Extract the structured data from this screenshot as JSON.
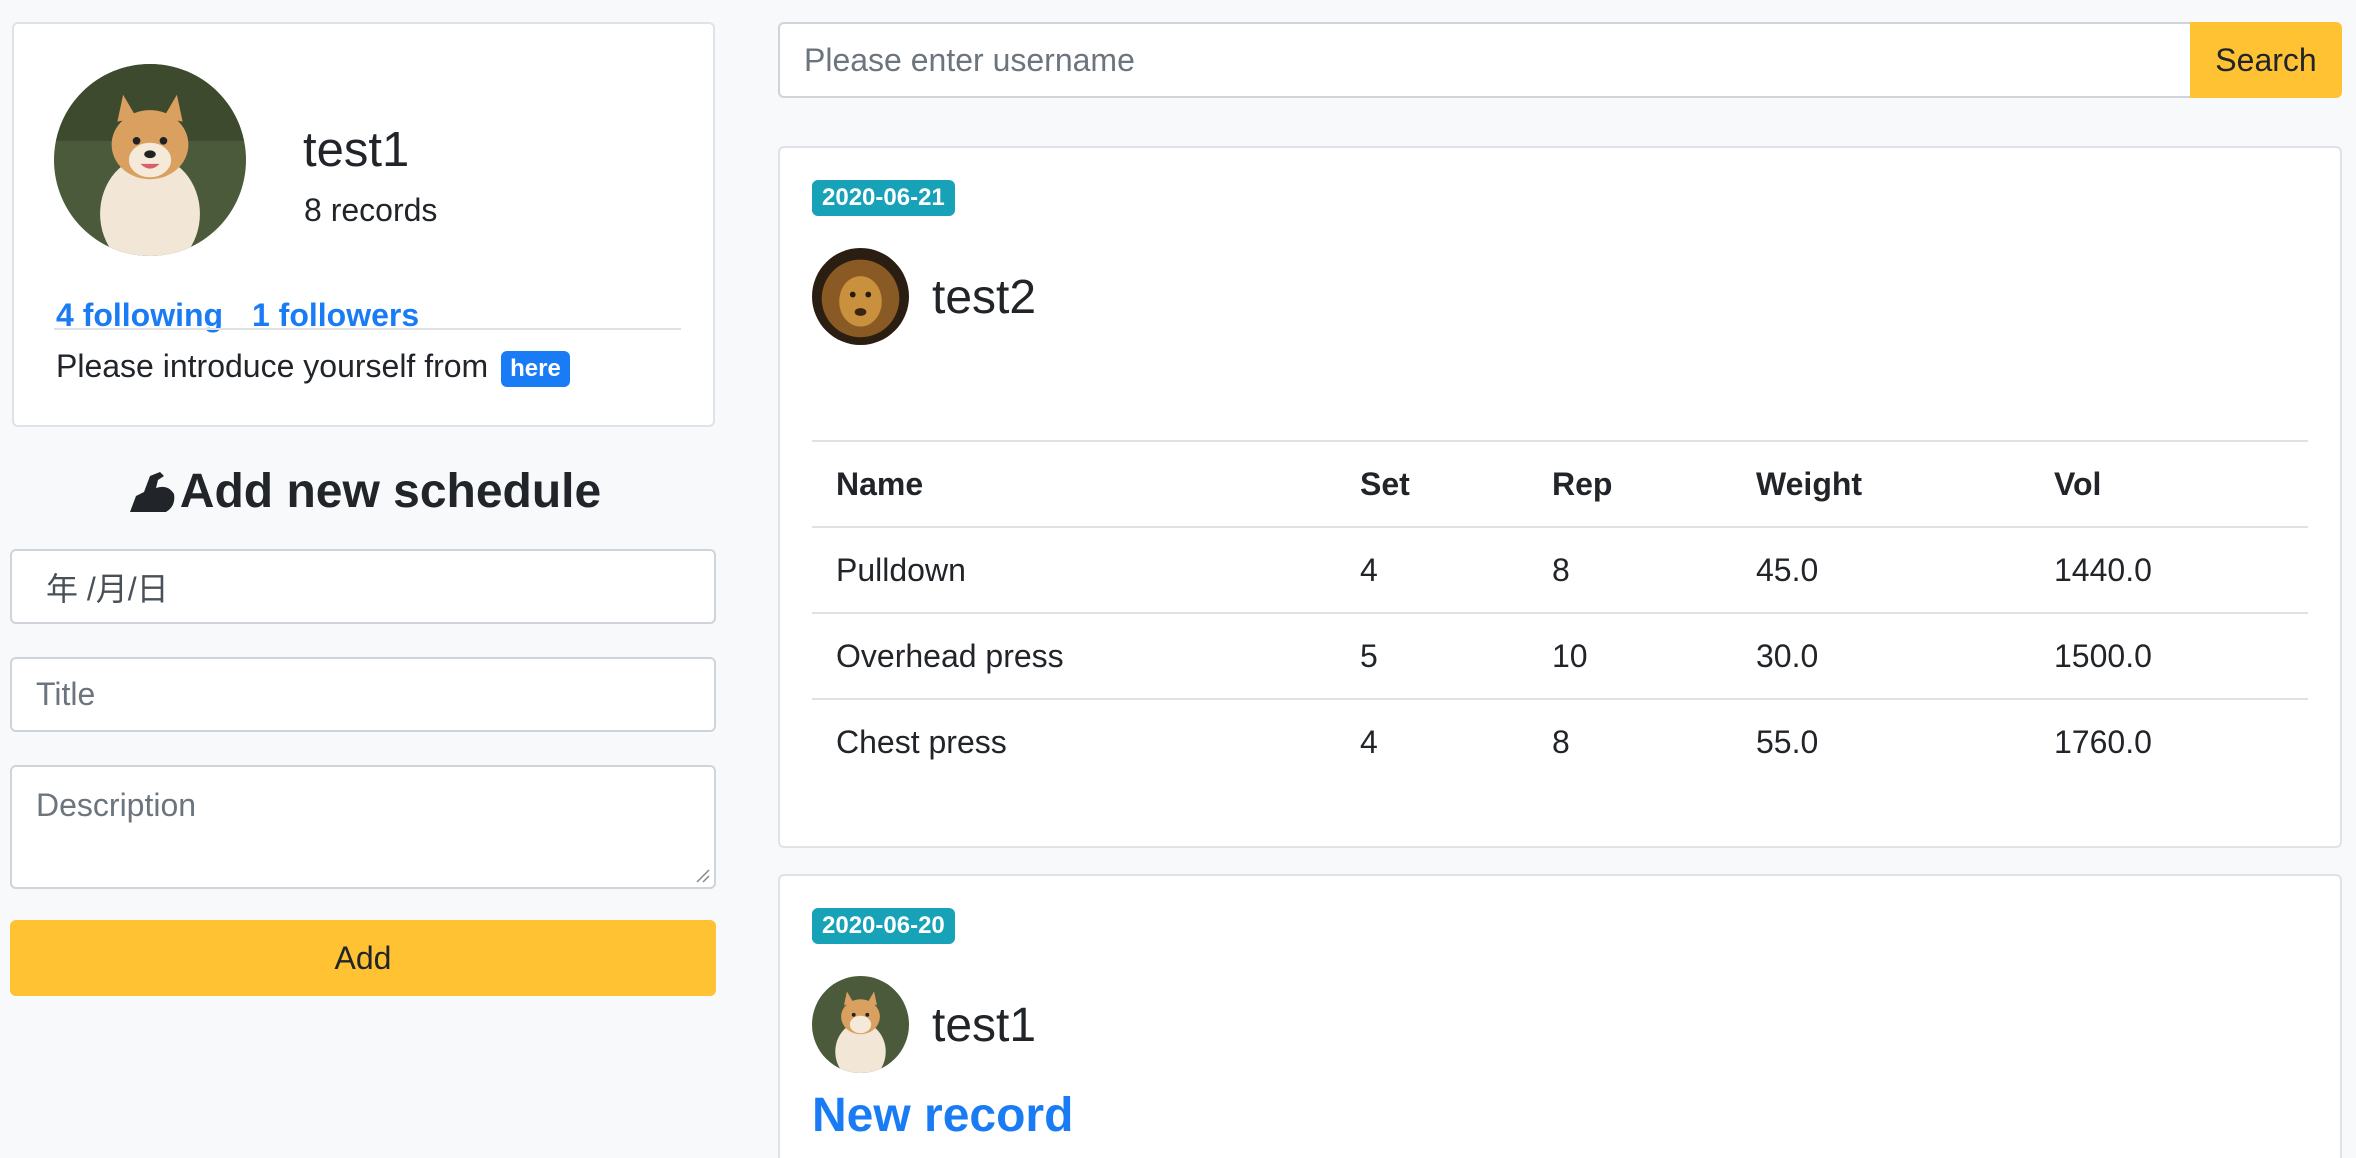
{
  "profile": {
    "name": "test1",
    "records": "8 records",
    "following": "4 following",
    "followers": "1 followers",
    "intro_text": "Please introduce yourself from",
    "intro_link": "here"
  },
  "schedule": {
    "heading": "Add new schedule",
    "date_value": "年 /月/日",
    "title_placeholder": "Title",
    "description_placeholder": "Description",
    "add_label": "Add"
  },
  "search": {
    "placeholder": "Please enter username",
    "button_label": "Search"
  },
  "posts": [
    {
      "date": "2020-06-21",
      "user": "test2",
      "table": {
        "headers": [
          "Name",
          "Set",
          "Rep",
          "Weight",
          "Vol"
        ],
        "rows": [
          [
            "Pulldown",
            "4",
            "8",
            "45.0",
            "1440.0"
          ],
          [
            "Overhead press",
            "5",
            "10",
            "30.0",
            "1500.0"
          ],
          [
            "Chest press",
            "4",
            "8",
            "55.0",
            "1760.0"
          ]
        ]
      }
    },
    {
      "date": "2020-06-20",
      "user": "test1",
      "title": "New record"
    }
  ],
  "colors": {
    "accent_yellow": "#ffc232",
    "link_blue": "#1a7cf5",
    "date_badge_teal": "#17a2b8"
  }
}
